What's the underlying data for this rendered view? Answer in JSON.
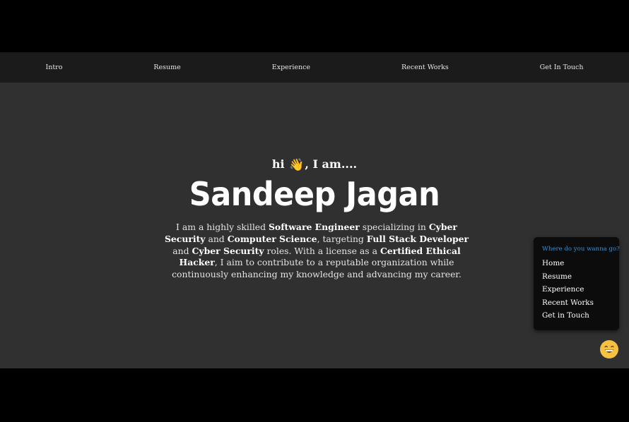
{
  "nav": {
    "items": [
      {
        "label": "Intro"
      },
      {
        "label": "Resume"
      },
      {
        "label": "Experience"
      },
      {
        "label": "Recent Works"
      },
      {
        "label": "Get In Touch"
      }
    ]
  },
  "hero": {
    "greeting_pre": "hi",
    "greeting_icon": "waving-hand-icon",
    "greeting_post": ", I am....",
    "name": "Sandeep Jagan",
    "bio": {
      "t1": "I am a highly skilled ",
      "b1": "Software Engineer",
      "t2": " specializing in ",
      "b2": "Cyber Security",
      "t3": " and ",
      "b3": "Computer Science",
      "t4": ", targeting ",
      "b4": "Full Stack Developer",
      "t5": " and ",
      "b5": "Cyber Security",
      "t6": " roles. With a license as a ",
      "b6": "Certified Ethical Hacker",
      "t7": ", I aim to contribute to a reputable organization while continuously enhancing my knowledge and advancing my career."
    }
  },
  "quick_nav": {
    "title": "Where do you wanna go?",
    "items": [
      {
        "label": "Home"
      },
      {
        "label": "Resume"
      },
      {
        "label": "Experience"
      },
      {
        "label": "Recent Works"
      },
      {
        "label": "Get in Touch"
      }
    ]
  },
  "chat_toggle": {
    "icon": "grinning-face-icon"
  },
  "colors": {
    "page_bg": "#303030",
    "navbar_bg": "#1b1b1b",
    "popup_bg": "#0c0c0c",
    "popup_title": "#3b8fd1",
    "emoji_yellow": "#f6c141"
  }
}
